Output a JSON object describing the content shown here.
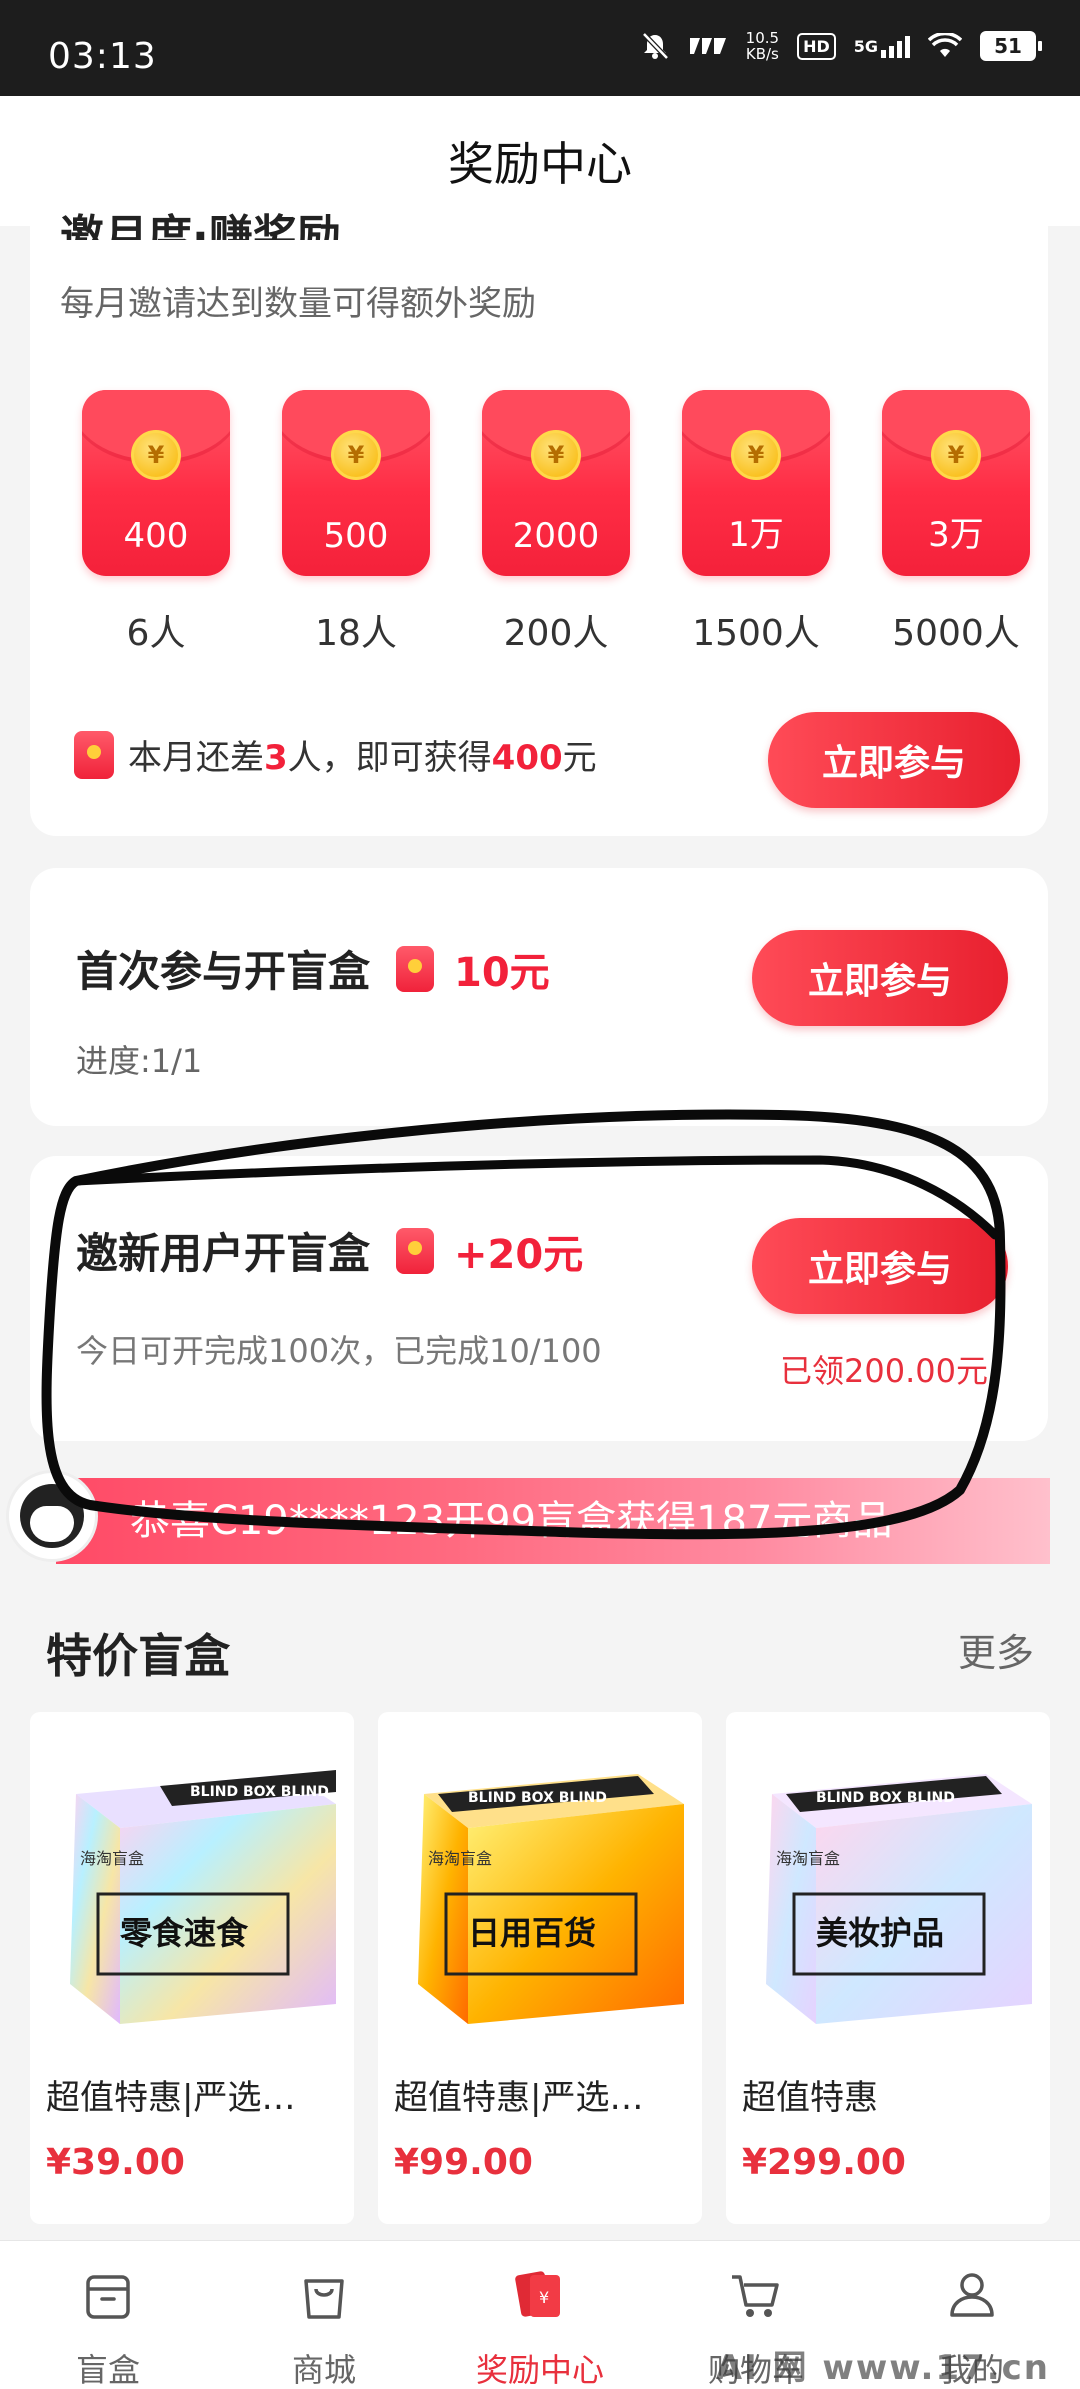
{
  "status_bar": {
    "time": "03:13",
    "net_speed_value": "10.5",
    "net_speed_unit": "KB/s",
    "hd": "HD",
    "network": "5G",
    "battery": "51"
  },
  "header": {
    "title": "奖励中心"
  },
  "monthly": {
    "title_partial": "邀月度·赚奖励",
    "subtitle": "每月邀请达到数量可得额外奖励",
    "tiers": [
      {
        "amount": "400",
        "people": "6人"
      },
      {
        "amount": "500",
        "people": "18人"
      },
      {
        "amount": "2000",
        "people": "200人"
      },
      {
        "amount": "1万",
        "people": "1500人"
      },
      {
        "amount": "3万",
        "people": "5000人"
      }
    ],
    "status_prefix": "本月还差",
    "status_count": "3",
    "status_mid": "人，即可获得",
    "status_reward": "400",
    "status_suffix": "元",
    "button": "立即参与"
  },
  "task_first": {
    "title": "首次参与开盲盒",
    "reward": "10元",
    "progress": "进度:1/1",
    "button": "立即参与"
  },
  "task_invite": {
    "title": "邀新用户开盲盒",
    "reward": "+20元",
    "progress": "今日可开完成100次，已完成10/100",
    "claimed": "已领200.00元",
    "button": "立即参与"
  },
  "ticker": {
    "text": "恭喜C19****123开99盲盒获得187元商品"
  },
  "section": {
    "title": "特价盲盒",
    "more": "更多"
  },
  "products": [
    {
      "name": "超值特惠|严选…",
      "price": "¥39.00",
      "box_label": "零食速食",
      "box_brand": "海淘盲盒",
      "stripe": "BLIND BOX BLIND",
      "theme": "holo"
    },
    {
      "name": "超值特惠|严选…",
      "price": "¥99.00",
      "box_label": "日用百货",
      "box_brand": "海淘盲盒",
      "stripe": "BLIND BOX BLIND",
      "theme": "gold"
    },
    {
      "name": "超值特惠",
      "price": "¥299.00",
      "box_label": "美妆护品",
      "box_brand": "海淘盲盒",
      "stripe": "BLIND BOX BLIND",
      "theme": "pastel"
    }
  ],
  "tabbar": [
    {
      "label": "盲盒",
      "icon": "box-icon"
    },
    {
      "label": "商城",
      "icon": "shopping-bag-icon"
    },
    {
      "label": "奖励中心",
      "icon": "red-envelope-icon",
      "active": true
    },
    {
      "label": "购物车",
      "icon": "cart-icon"
    },
    {
      "label": "我的",
      "icon": "user-icon"
    }
  ],
  "watermark": "AI 网  www.17.cn"
}
